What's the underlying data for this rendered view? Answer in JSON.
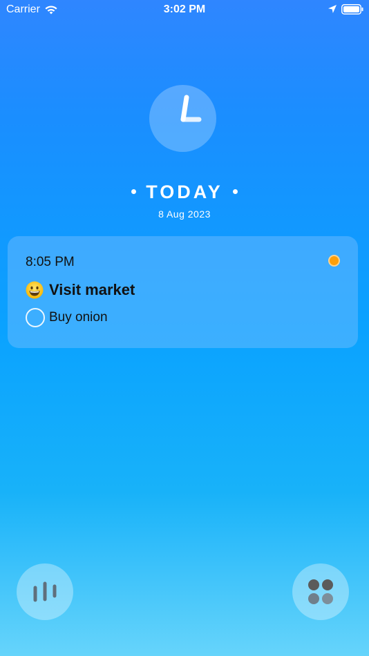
{
  "status_bar": {
    "carrier": "Carrier",
    "time": "3:02 PM"
  },
  "header": {
    "title": "TODAY",
    "date": "8 Aug 2023"
  },
  "event": {
    "time": "8:05 PM",
    "emoji": "grinning-face",
    "title": "Visit market",
    "status_color": "#ff9f0a",
    "tasks": [
      {
        "label": "Buy onion",
        "done": false
      }
    ]
  },
  "icons": {
    "clock": "clock-icon",
    "stats": "bar-chart-icon",
    "menu": "grid-dots-icon"
  },
  "colors": {
    "background_top": "#2f86ff",
    "background_bottom": "#66d4fb",
    "accent_orange": "#ff9f0a"
  }
}
